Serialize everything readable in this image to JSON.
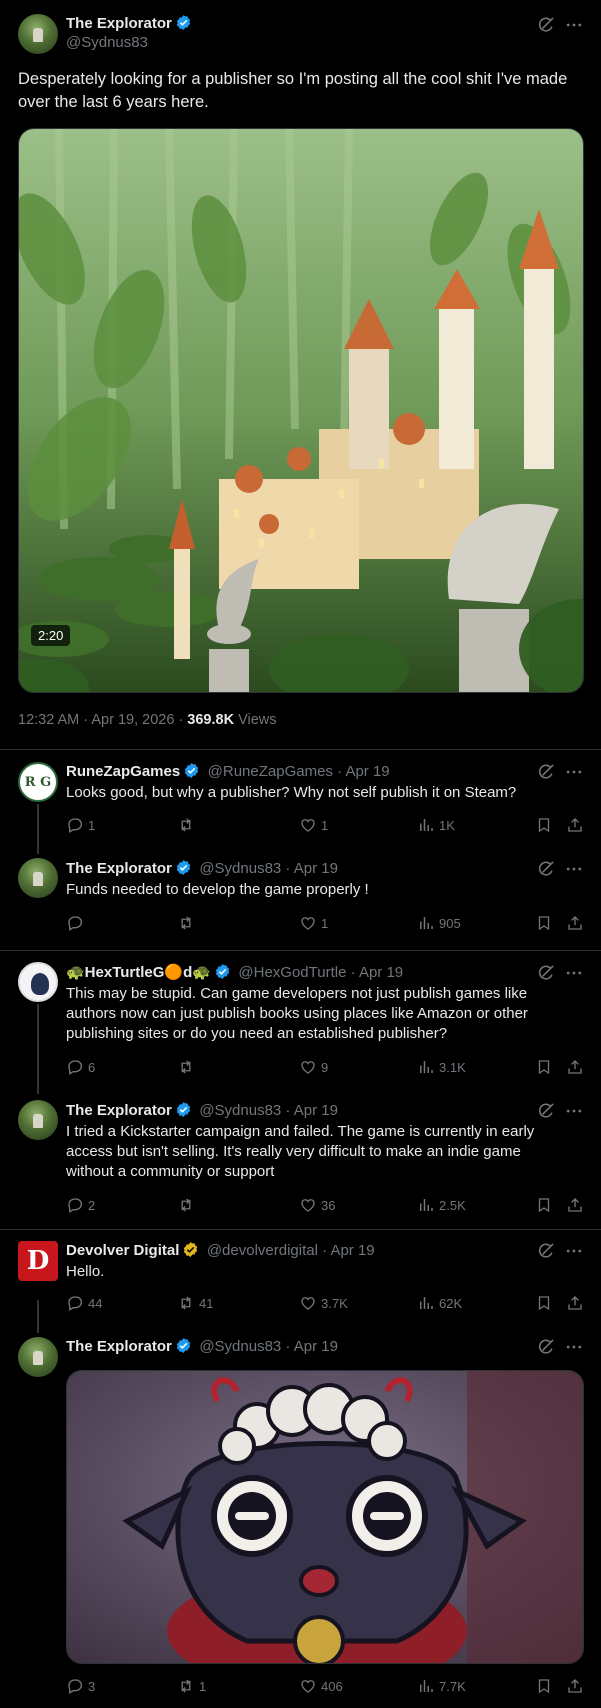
{
  "main_tweet": {
    "author_name": "The Explorator",
    "handle": "@Sydnus83",
    "text": "Desperately looking for a publisher so I'm posting all the cool shit I've made over the last 6 years here.",
    "video_duration": "2:20",
    "timestamp": "12:32 AM · Apr 19, 2026 · ",
    "views_count": "369.8K",
    "views_label": " Views"
  },
  "replies": [
    {
      "author_name": "RuneZapGames",
      "handle": "@RuneZapGames",
      "date": " · Apr 19",
      "text": "Looks good, but why a publisher? Why not self publish it on Steam?",
      "replies": "1",
      "reposts": "",
      "likes": "1",
      "views": "1K",
      "avatar": "R G"
    },
    {
      "author_name": "The Explorator",
      "handle": "@Sydnus83",
      "date": " · Apr 19",
      "text": "Funds needed to develop the game properly !",
      "replies": "",
      "reposts": "",
      "likes": "1",
      "views": "905"
    },
    {
      "author_name": "🐢HexTurtleG🟠d🐢",
      "handle": "@HexGodTurtle",
      "date": " · Apr 19",
      "text": "This may be stupid.  Can game developers not just publish games like authors now can just publish books using places like Amazon or other publishing sites or do you need an established publisher?",
      "replies": "6",
      "reposts": "",
      "likes": "9",
      "views": "3.1K"
    },
    {
      "author_name": "The Explorator",
      "handle": "@Sydnus83",
      "date": " · Apr 19",
      "text": "I tried a Kickstarter campaign and failed. The game is currently in early access but isn't selling. It's really very difficult to make an indie game without a community or support",
      "replies": "2",
      "reposts": "",
      "likes": "36",
      "views": "2.5K"
    },
    {
      "author_name": "Devolver Digital",
      "handle": "@devolverdigital",
      "date": " · Apr 19",
      "text": "Hello.",
      "replies": "44",
      "reposts": "41",
      "likes": "3.7K",
      "views": "62K",
      "avatar": "D"
    },
    {
      "author_name": "The Explorator",
      "handle": "@Sydnus83",
      "date": " · Apr 19",
      "text": "",
      "replies": "3",
      "reposts": "1",
      "likes": "406",
      "views": "7.7K"
    }
  ],
  "colors": {
    "background": "#000000",
    "text": "#e7e9ea",
    "muted": "#71767b",
    "verified_blue": "#1d9bf0",
    "verified_gold": "#e2b719",
    "divider": "#2f3336"
  },
  "icons": [
    "grok-icon",
    "more-icon",
    "reply-icon",
    "repost-icon",
    "like-icon",
    "views-icon",
    "bookmark-icon",
    "share-icon",
    "verified-badge-icon"
  ]
}
